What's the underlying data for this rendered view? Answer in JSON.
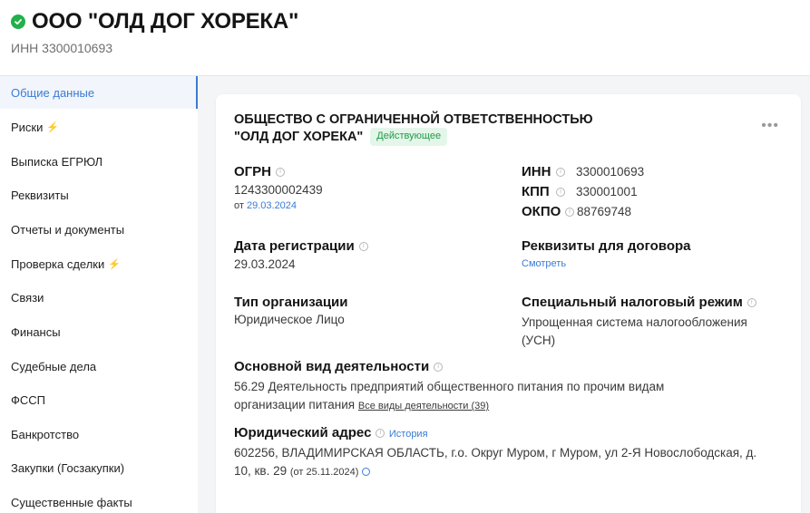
{
  "header": {
    "company_title": "ООО \"ОЛД ДОГ ХОРЕКА\"",
    "inn_line": "ИНН 3300010693"
  },
  "sidebar": {
    "items": [
      {
        "label": "Общие данные"
      },
      {
        "label": "Риски"
      },
      {
        "label": "Выписка ЕГРЮЛ"
      },
      {
        "label": "Реквизиты"
      },
      {
        "label": "Отчеты и документы"
      },
      {
        "label": "Проверка сделки"
      },
      {
        "label": "Связи"
      },
      {
        "label": "Финансы"
      },
      {
        "label": "Судебные дела"
      },
      {
        "label": "ФССП"
      },
      {
        "label": "Банкротство"
      },
      {
        "label": "Закупки (Госзакупки)"
      },
      {
        "label": "Существенные факты"
      }
    ],
    "bolt_glyph": "⚡"
  },
  "card": {
    "fullname_line1": "ОБЩЕСТВО С ОГРАНИЧЕННОЙ ОТВЕТСТВЕННОСТЬЮ",
    "fullname_line2": "\"ОЛД ДОГ ХОРЕКА\"",
    "status": "Действующее",
    "more": "•••",
    "ogrn": {
      "label": "ОГРН",
      "value": "1243300002439",
      "date_prefix": "от",
      "date": "29.03.2024"
    },
    "inn": {
      "label": "ИНН",
      "value": "3300010693"
    },
    "kpp": {
      "label": "КПП",
      "value": "330001001"
    },
    "okpo": {
      "label": "ОКПО",
      "value": "88769748"
    },
    "registration": {
      "label": "Дата регистрации",
      "value": "29.03.2024"
    },
    "contract_details": {
      "label": "Реквизиты для договора",
      "link": "Смотреть"
    },
    "org_type": {
      "label": "Тип организации",
      "value": "Юридическое Лицо"
    },
    "tax_regime": {
      "label": "Специальный налоговый режим",
      "value_line1": "Упрощенная система налогообложения",
      "value_line2": "(УСН)"
    },
    "activity": {
      "label": "Основной вид деятельности",
      "value_line1": "56.29 Деятельность предприятий общественного питания по прочим видам",
      "value_line2": "организации питания",
      "all_link": "Все виды деятельности (39)"
    },
    "address": {
      "label": "Юридический адрес",
      "history": "История",
      "value_line1": "602256, ВЛАДИМИРСКАЯ ОБЛАСТЬ, г.о. Округ Муром, г Муром, ул 2-Я Новослободская, д.",
      "value_line2": "10, кв. 29",
      "since": "(от 25.11.2024)"
    },
    "info_glyph": "i"
  },
  "colors": {
    "accent": "#3a7bd5",
    "success": "#22b04a",
    "badge_bg": "#e4f6ea",
    "bolt": "#f5a623"
  }
}
